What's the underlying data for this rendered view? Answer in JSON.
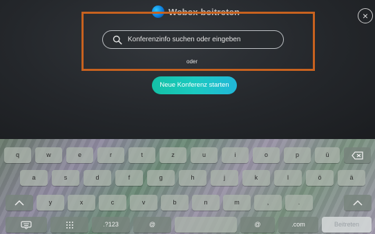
{
  "header": {
    "title": "Webex beitreten",
    "close_label": "×"
  },
  "search": {
    "placeholder": "Konferenzinfo suchen oder eingeben"
  },
  "divider_text": "oder",
  "start_button_label": "Neue Konferenz starten",
  "keyboard": {
    "row1": [
      "q",
      "w",
      "e",
      "r",
      "t",
      "z",
      "u",
      "i",
      "o",
      "p",
      "ü"
    ],
    "row2": [
      "a",
      "s",
      "d",
      "f",
      "g",
      "h",
      "j",
      "k",
      "l",
      "ö",
      "ä"
    ],
    "row3": [
      "y",
      "x",
      "c",
      "v",
      "b",
      "n",
      "m",
      ",",
      "."
    ],
    "numbers_key": ".?123",
    "dotcom_key": ".com",
    "at_key": "@",
    "submit_key": "Beitreten"
  },
  "colors": {
    "highlight": "#c8621f",
    "start_button": "#1bc9c0"
  }
}
